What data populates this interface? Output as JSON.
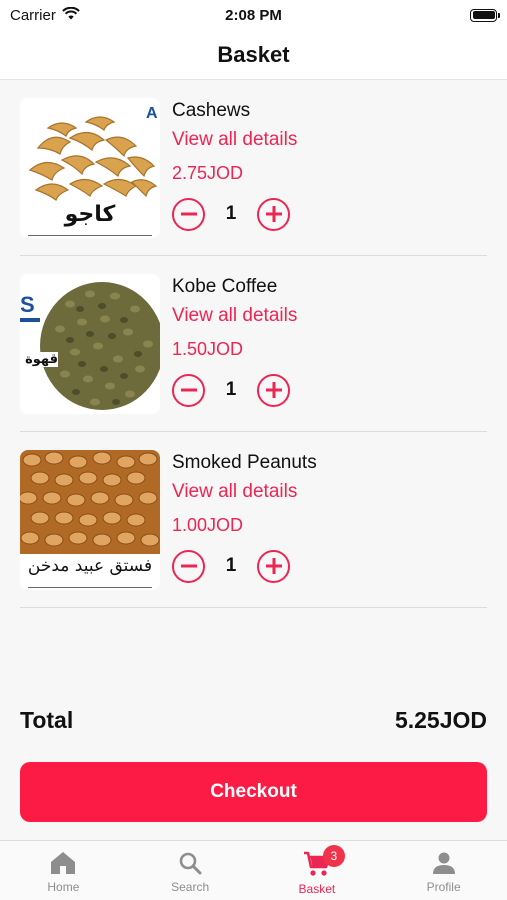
{
  "status_bar": {
    "carrier": "Carrier",
    "time": "2:08 PM"
  },
  "header": {
    "title": "Basket"
  },
  "items": [
    {
      "name": "Cashews",
      "link_label": "View all details",
      "price": "2.75JOD",
      "quantity": "1",
      "image_caption": "كاجو",
      "image": "cashews-photo"
    },
    {
      "name": "Kobe Coffee",
      "link_label": "View all details",
      "price": "1.50JOD",
      "quantity": "1",
      "image_caption": "قهوة ك",
      "image": "coffee-beans-photo"
    },
    {
      "name": "Smoked Peanuts",
      "link_label": "View all details",
      "price": "1.00JOD",
      "quantity": "1",
      "image_caption": "فستق عبيد مدخن",
      "image": "peanuts-photo"
    }
  ],
  "summary": {
    "total_label": "Total",
    "total_value": "5.25JOD"
  },
  "checkout": {
    "label": "Checkout"
  },
  "tab_bar": {
    "tabs": [
      {
        "label": "Home",
        "icon": "home-icon"
      },
      {
        "label": "Search",
        "icon": "search-icon"
      },
      {
        "label": "Basket",
        "icon": "cart-icon",
        "badge": "3",
        "active": true
      },
      {
        "label": "Profile",
        "icon": "profile-icon"
      }
    ]
  },
  "colors": {
    "accent": "#ec2654",
    "checkout_bg": "#fb1b44",
    "badge": "#f0334a"
  }
}
